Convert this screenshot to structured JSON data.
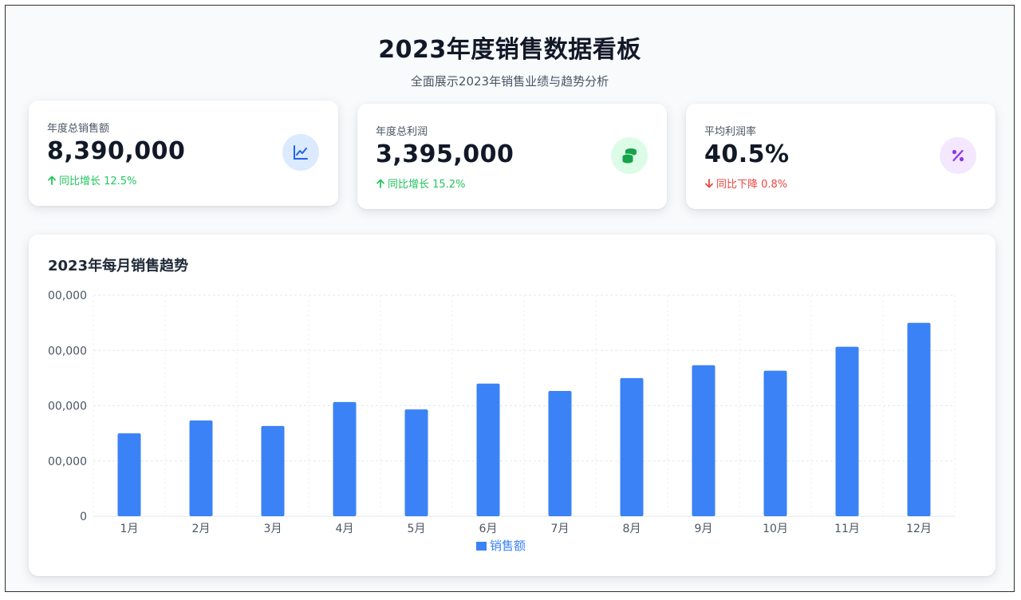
{
  "header": {
    "title": "2023年度销售数据看板",
    "subtitle": "全面展示2023年销售业绩与趋势分析"
  },
  "stats": [
    {
      "label": "年度总销售额",
      "value": "8,390,000",
      "change": "同比增长 12.5%",
      "direction": "up",
      "icon": "line-chart-icon",
      "icon_color": "#2563eb",
      "icon_bg": "#dbeafe"
    },
    {
      "label": "年度总利润",
      "value": "3,395,000",
      "change": "同比增长 15.2%",
      "direction": "up",
      "icon": "coins-icon",
      "icon_color": "#16a34a",
      "icon_bg": "#dcfce7"
    },
    {
      "label": "平均利润率",
      "value": "40.5%",
      "change": "同比下降 0.8%",
      "direction": "down",
      "icon": "percent-icon",
      "icon_color": "#9333ea",
      "icon_bg": "#f3e8ff"
    }
  ],
  "chart": {
    "title": "2023年每月销售趋势"
  },
  "chart_data": {
    "type": "bar",
    "categories": [
      "1月",
      "2月",
      "3月",
      "4月",
      "5月",
      "6月",
      "7月",
      "8月",
      "9月",
      "10月",
      "11月",
      "12月"
    ],
    "series": [
      {
        "name": "销售额",
        "values": [
          450000,
          520000,
          490000,
          620000,
          580000,
          720000,
          680000,
          750000,
          820000,
          790000,
          920000,
          1050000
        ],
        "color": "#3b82f6"
      }
    ],
    "y_ticks": [
      0,
      300000,
      600000,
      900000,
      1200000
    ],
    "y_tick_labels": [
      "0",
      "00,000",
      "00,000",
      "00,000",
      "00,000"
    ],
    "ylim": [
      0,
      1200000
    ],
    "grid": true,
    "legend": "bottom-center"
  }
}
